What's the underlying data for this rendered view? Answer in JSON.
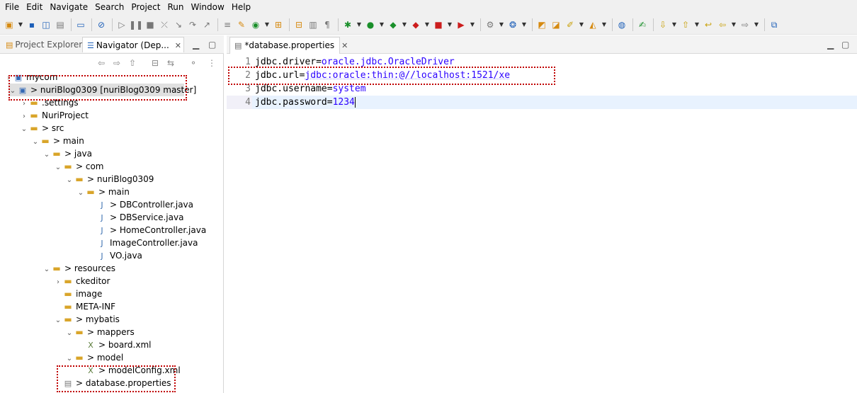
{
  "menu": [
    "File",
    "Edit",
    "Navigate",
    "Search",
    "Project",
    "Run",
    "Window",
    "Help"
  ],
  "left_panel": {
    "tabs": [
      {
        "label": "Project Explorer"
      },
      {
        "label": "Navigator (Dep..."
      }
    ],
    "close_glyph": "✕",
    "tree": [
      {
        "label": "mycom"
      },
      {
        "label": "> nuriBlog0309 [nuriBlog0309 master]"
      },
      {
        "label": ".settings"
      },
      {
        "label": "NuriProject"
      },
      {
        "label": "> src"
      },
      {
        "label": "> main"
      },
      {
        "label": "> java"
      },
      {
        "label": "> com"
      },
      {
        "label": "> nuriBlog0309"
      },
      {
        "label": "> main"
      },
      {
        "label": "> DBController.java"
      },
      {
        "label": "> DBService.java"
      },
      {
        "label": "> HomeController.java"
      },
      {
        "label": "ImageController.java"
      },
      {
        "label": "VO.java"
      },
      {
        "label": "> resources"
      },
      {
        "label": "ckeditor"
      },
      {
        "label": "image"
      },
      {
        "label": "META-INF"
      },
      {
        "label": "> mybatis"
      },
      {
        "label": "> mappers"
      },
      {
        "label": "> board.xml"
      },
      {
        "label": "> model"
      },
      {
        "label": "> modelConfig.xml"
      },
      {
        "label": "> database.properties"
      }
    ]
  },
  "editor": {
    "tab_label": "*database.properties",
    "lines": [
      {
        "num": "1",
        "key": "jdbc.driver",
        "eq": "=",
        "value": "oracle.jdbc.OracleDriver"
      },
      {
        "num": "2",
        "key": "jdbc.url",
        "eq": "=",
        "value": "jdbc:oracle:thin:@//localhost:1521/xe"
      },
      {
        "num": "3",
        "key": "jdbc.username",
        "eq": "=",
        "value": "system"
      },
      {
        "num": "4",
        "key": "jdbc.password",
        "eq": "=",
        "value": "1234"
      }
    ]
  },
  "colors": {
    "annotation_box": "#c00000",
    "property_value": "#2a00ff",
    "current_line": "#e8f2fe"
  }
}
